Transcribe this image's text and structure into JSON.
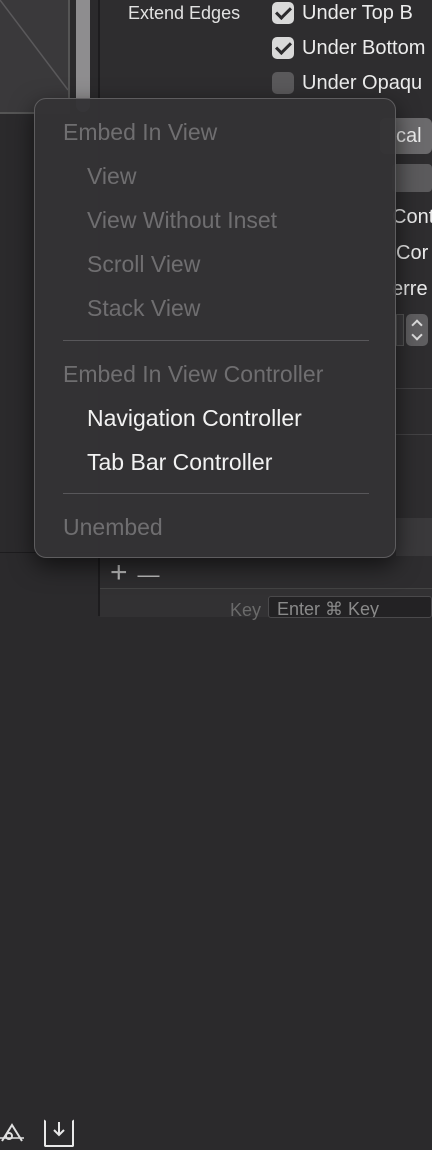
{
  "inspector": {
    "extend_edges_label": "Extend Edges",
    "checkboxes": [
      {
        "label": "Under Top B",
        "checked": true
      },
      {
        "label": "Under Bottom",
        "checked": true
      },
      {
        "label": "Under Opaqu",
        "checked": false
      }
    ],
    "popup_1": "cal",
    "right_fragments": [
      "Cont",
      "Cor",
      "erre"
    ]
  },
  "canvas": {
    "align_icon": "align-triangle-icon",
    "embed_icon": "embed-in-icon",
    "add_label": "+",
    "remove_label": "—"
  },
  "bottom": {
    "key_label": "Key",
    "key_placeholder": "Enter ⌘ Key"
  },
  "menu": {
    "section_1": {
      "header": "Embed In View",
      "items": [
        "View",
        "View Without Inset",
        "Scroll View",
        "Stack View"
      ]
    },
    "section_2": {
      "header": "Embed In View Controller",
      "items": [
        "Navigation Controller",
        "Tab Bar Controller"
      ]
    },
    "unembed": "Unembed"
  },
  "colors": {
    "menu_bg": "#343335",
    "disabled_text": "#6f6e70",
    "enabled_text": "#f2f2f2"
  }
}
